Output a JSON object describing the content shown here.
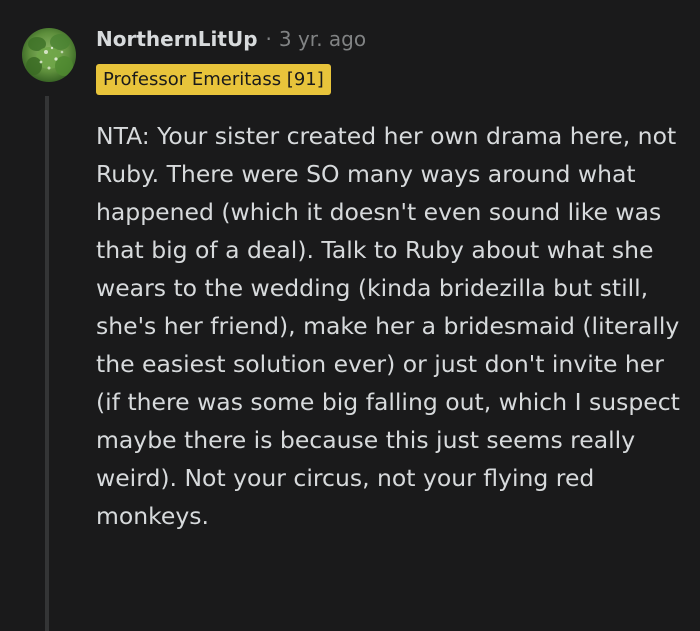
{
  "comment": {
    "author": "NorthernLitUp",
    "separator": "·",
    "timestamp": "3 yr. ago",
    "flair": "Professor Emeritass [91]",
    "body": "NTA: Your sister created her own drama here, not Ruby. There were SO many ways around what happened (which it doesn't even sound like was that big of a deal). Talk to Ruby about what she wears to the wedding (kinda bridezilla but still, she's her friend), make her a bridesmaid (literally the easiest solution ever) or just don't invite her (if there was some big falling out, which I suspect maybe there is because this just seems really weird). Not your circus, not your flying red monkeys."
  },
  "colors": {
    "background": "#1a1a1b",
    "text": "#d7dadc",
    "muted": "#818384",
    "flair_bg": "#e8c43b",
    "thread_line": "#343536"
  },
  "icons": {
    "avatar": "avatar-icon"
  }
}
